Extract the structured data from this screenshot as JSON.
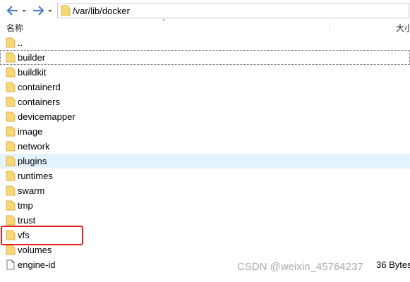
{
  "toolbar": {
    "address": "/var/lib/docker"
  },
  "header": {
    "name_col": "名称",
    "size_col": "大小"
  },
  "items": [
    {
      "name": "..",
      "type": "folder",
      "size": ""
    },
    {
      "name": "builder",
      "type": "folder",
      "size": ""
    },
    {
      "name": "buildkit",
      "type": "folder",
      "size": ""
    },
    {
      "name": "containerd",
      "type": "folder",
      "size": ""
    },
    {
      "name": "containers",
      "type": "folder",
      "size": ""
    },
    {
      "name": "devicemapper",
      "type": "folder",
      "size": ""
    },
    {
      "name": "image",
      "type": "folder",
      "size": ""
    },
    {
      "name": "network",
      "type": "folder",
      "size": ""
    },
    {
      "name": "plugins",
      "type": "folder",
      "size": ""
    },
    {
      "name": "runtimes",
      "type": "folder",
      "size": ""
    },
    {
      "name": "swarm",
      "type": "folder",
      "size": ""
    },
    {
      "name": "tmp",
      "type": "folder",
      "size": ""
    },
    {
      "name": "trust",
      "type": "folder",
      "size": ""
    },
    {
      "name": "vfs",
      "type": "folder",
      "size": ""
    },
    {
      "name": "volumes",
      "type": "folder",
      "size": ""
    },
    {
      "name": "engine-id",
      "type": "file",
      "size": "36 Bytes"
    }
  ],
  "colors": {
    "highlight": "#e8201d",
    "hover_row": "#e5f3ff",
    "folder": "#f8d775"
  },
  "watermark": "CSDN @weixin_45764237"
}
